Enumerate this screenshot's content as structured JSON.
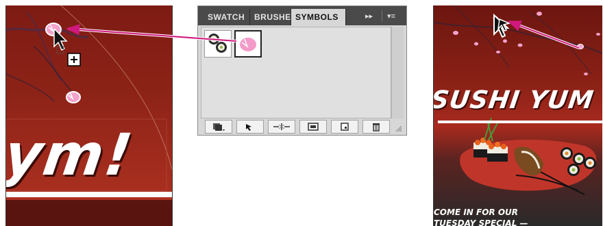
{
  "left_art": {
    "headline": "ym!"
  },
  "panel": {
    "tabs": [
      {
        "label": "SWATCH",
        "active": false
      },
      {
        "label": "BRUSHES",
        "active": false
      },
      {
        "label": "SYMBOLS",
        "active": true
      }
    ],
    "symbols": [
      {
        "name": "sushi-roll-symbol",
        "selected": false
      },
      {
        "name": "cherry-blossom-symbol",
        "selected": true
      }
    ],
    "toolbar": [
      "symbol-libraries-menu",
      "place-symbol-instance",
      "break-link-to-symbol",
      "symbol-options",
      "new-symbol",
      "delete-symbol"
    ]
  },
  "right_art": {
    "title": "SUSHI YUM",
    "promo_line1": "COME IN FOR OUR",
    "promo_line2": "TUESDAY SPECIAL —"
  },
  "colors": {
    "arrow": "#d0187e",
    "petal": "#f49ac8",
    "art_red": "#8d2317",
    "panel_grey": "#d7d7d7",
    "tab_dark": "#4a4a4a"
  }
}
